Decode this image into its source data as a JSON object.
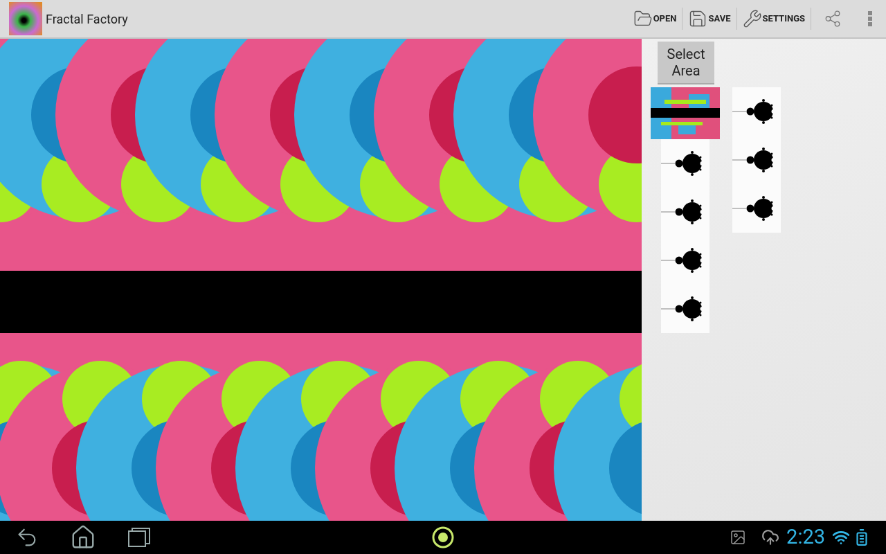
{
  "action_bar": {
    "title": "Fractal Factory",
    "actions": [
      {
        "kind": "open",
        "label": "OPEN"
      },
      {
        "kind": "save",
        "label": "SAVE"
      },
      {
        "kind": "settings",
        "label": "SETTINGS"
      }
    ]
  },
  "sidebar": {
    "select_button": "Select Area",
    "thumbnail_columns": [
      [
        {
          "kind": "color"
        },
        {
          "kind": "mandelbrot"
        },
        {
          "kind": "mandelbrot"
        },
        {
          "kind": "mandelbrot"
        },
        {
          "kind": "mandelbrot"
        }
      ],
      [
        {
          "kind": "mandelbrot"
        },
        {
          "kind": "mandelbrot"
        },
        {
          "kind": "mandelbrot"
        }
      ]
    ]
  },
  "system_bar": {
    "time": "2:23"
  }
}
